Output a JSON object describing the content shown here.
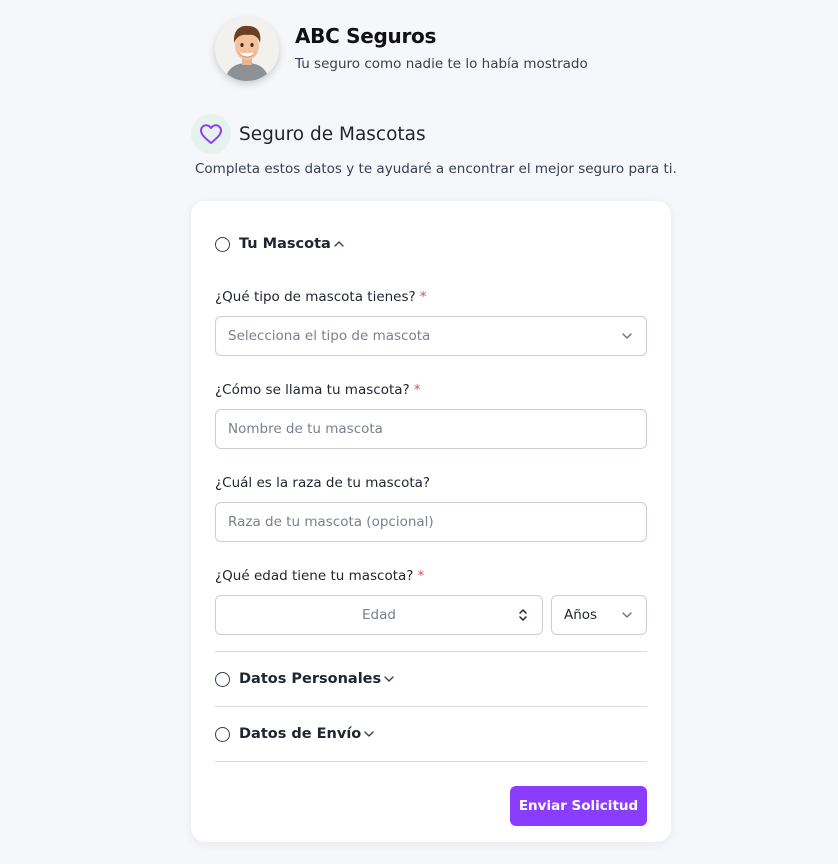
{
  "header": {
    "brand_name": "ABC Seguros",
    "tagline": "Tu seguro como nadie te lo había mostrado",
    "avatar_icon": "cartoon-man-avatar"
  },
  "section": {
    "icon": "heart-icon",
    "title": "Seguro de Mascotas",
    "subtitle": "Completa estos datos y te ayudaré a encontrar el mejor seguro para ti."
  },
  "form": {
    "steps": [
      {
        "label": "Tu Mascota",
        "expanded": true
      },
      {
        "label": "Datos Personales",
        "expanded": false
      },
      {
        "label": "Datos de Envío",
        "expanded": false
      }
    ],
    "fields": {
      "pet_type": {
        "label": "¿Qué tipo de mascota tienes?",
        "required_mark": "*",
        "placeholder": "Selecciona el tipo de mascota"
      },
      "pet_name": {
        "label": "¿Cómo se llama tu mascota?",
        "required_mark": "*",
        "placeholder": "Nombre de tu mascota"
      },
      "pet_breed": {
        "label": "¿Cuál es la raza de tu mascota?",
        "placeholder": "Raza de tu mascota (opcional)"
      },
      "pet_age": {
        "label": "¿Qué edad tiene tu mascota?",
        "required_mark": "*",
        "placeholder": "Edad",
        "unit_selected": "Años"
      }
    },
    "submit_label": "Enviar Solicitud"
  },
  "colors": {
    "accent": "#8b3dff",
    "required": "#e5484d",
    "heart_bg": "#e6f3ec",
    "page_bg": "#f6f7fa"
  }
}
